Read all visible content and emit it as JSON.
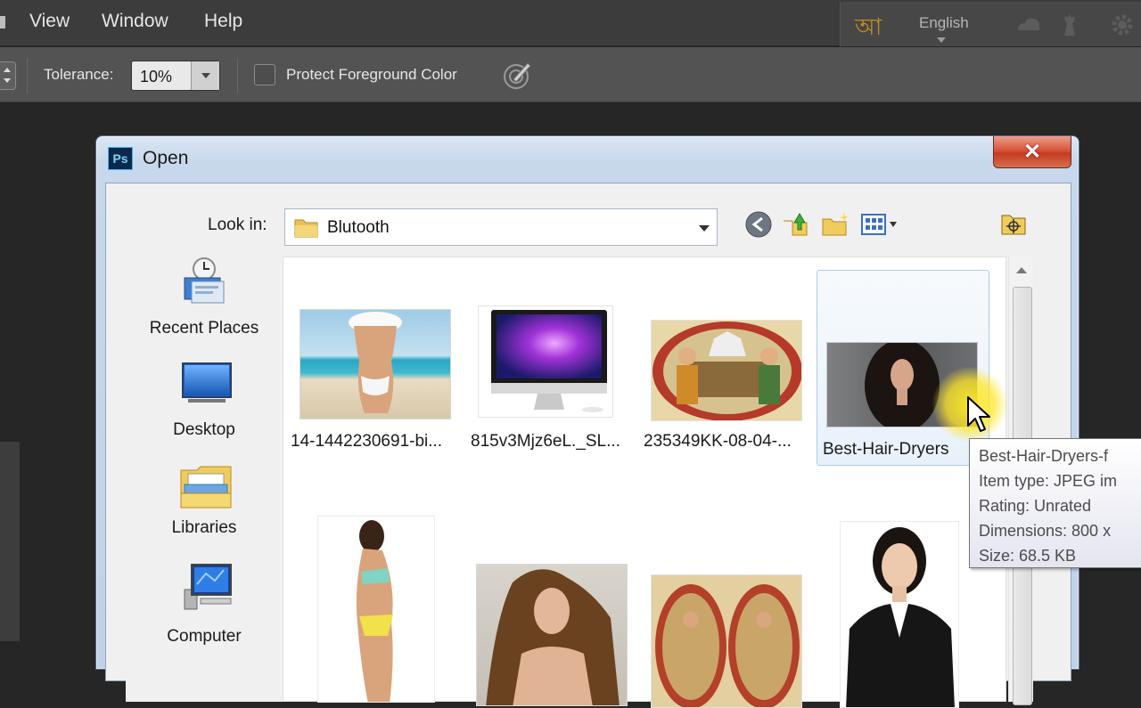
{
  "menubar": {
    "items": [
      "View",
      "Window",
      "Help"
    ],
    "language": "English"
  },
  "options": {
    "tolerance_label": "Tolerance:",
    "tolerance_value": "10%",
    "protect_label": "Protect Foreground Color",
    "protect_checked": false
  },
  "dialog": {
    "title": "Open",
    "app_badge": "Ps",
    "close_glyph": "✕",
    "look_in_label": "Look in:",
    "look_in_value": "Blutooth",
    "places": [
      {
        "label": "Recent Places",
        "icon": "recent-places-icon"
      },
      {
        "label": "Desktop",
        "icon": "desktop-icon"
      },
      {
        "label": "Libraries",
        "icon": "libraries-icon"
      },
      {
        "label": "Computer",
        "icon": "computer-icon"
      }
    ],
    "files": [
      {
        "name": "14-1442230691-bi..."
      },
      {
        "name": "815v3Mjz6eL._SL..."
      },
      {
        "name": "235349KK-08-04-..."
      },
      {
        "name": "Best-Hair-Dryers",
        "selected": true
      },
      {
        "name": ""
      },
      {
        "name": ""
      },
      {
        "name": ""
      },
      {
        "name": ""
      }
    ]
  },
  "tooltip": {
    "lines": [
      "Best-Hair-Dryers-f",
      "Item type: JPEG im",
      "Rating: Unrated",
      "Dimensions: 800 x",
      "Size: 68.5 KB"
    ]
  }
}
